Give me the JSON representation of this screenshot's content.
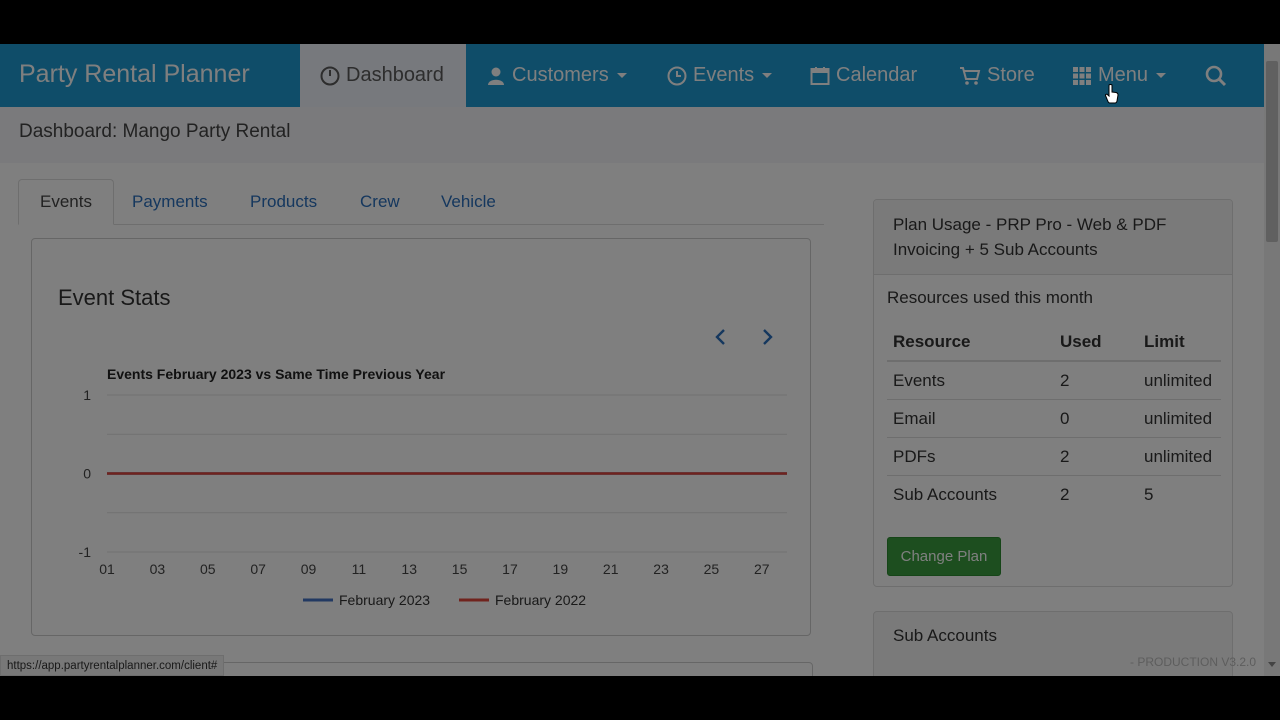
{
  "brand": "Party Rental Planner",
  "nav": {
    "dashboard": "Dashboard",
    "customers": "Customers",
    "events": "Events",
    "calendar": "Calendar",
    "store": "Store",
    "menu": "Menu"
  },
  "breadcrumb": "Dashboard: Mango Party Rental",
  "tabs": [
    "Events",
    "Payments",
    "Products",
    "Crew",
    "Vehicle"
  ],
  "active_tab": "Events",
  "stats_panel": {
    "title": "Event Stats"
  },
  "chart_data": {
    "type": "line",
    "title": "Events February 2023 vs Same Time Previous Year",
    "x": [
      "01",
      "02",
      "03",
      "04",
      "05",
      "06",
      "07",
      "08",
      "09",
      "10",
      "11",
      "12",
      "13",
      "14",
      "15",
      "16",
      "17",
      "18",
      "19",
      "20",
      "21",
      "22",
      "23",
      "24",
      "25",
      "26",
      "27",
      "28"
    ],
    "x_tick_labels": [
      "01",
      "03",
      "05",
      "07",
      "09",
      "11",
      "13",
      "15",
      "17",
      "19",
      "21",
      "23",
      "25",
      "27"
    ],
    "y_ticks": [
      1,
      0,
      -1
    ],
    "ylim": [
      -1,
      1
    ],
    "series": [
      {
        "name": "February 2023",
        "color": "#4472c4",
        "values": [
          0,
          0,
          0,
          0,
          0,
          0,
          0,
          0,
          0,
          0,
          0,
          0,
          0,
          0,
          0,
          0,
          0,
          0,
          0,
          0,
          0,
          0,
          0,
          0,
          0,
          0,
          0,
          0
        ]
      },
      {
        "name": "February 2022",
        "color": "#e0463a",
        "values": [
          0,
          0,
          0,
          0,
          0,
          0,
          0,
          0,
          0,
          0,
          0,
          0,
          0,
          0,
          0,
          0,
          0,
          0,
          0,
          0,
          0,
          0,
          0,
          0,
          0,
          0,
          0,
          0
        ]
      }
    ],
    "legend": "bottom-center",
    "grid": true
  },
  "plan": {
    "title": "Plan Usage - PRP Pro - Web & PDF Invoicing + 5 Sub Accounts",
    "subtitle": "Resources used this month",
    "headers": [
      "Resource",
      "Used",
      "Limit"
    ],
    "rows": [
      [
        "Events",
        "2",
        "unlimited"
      ],
      [
        "Email",
        "0",
        "unlimited"
      ],
      [
        "PDFs",
        "2",
        "unlimited"
      ],
      [
        "Sub Accounts",
        "2",
        "5"
      ]
    ],
    "button": "Change Plan"
  },
  "sub_accounts": {
    "title": "Sub Accounts"
  },
  "version": "- PRODUCTION V3.2.0",
  "status_url": "https://app.partyrentalplanner.com/client#"
}
